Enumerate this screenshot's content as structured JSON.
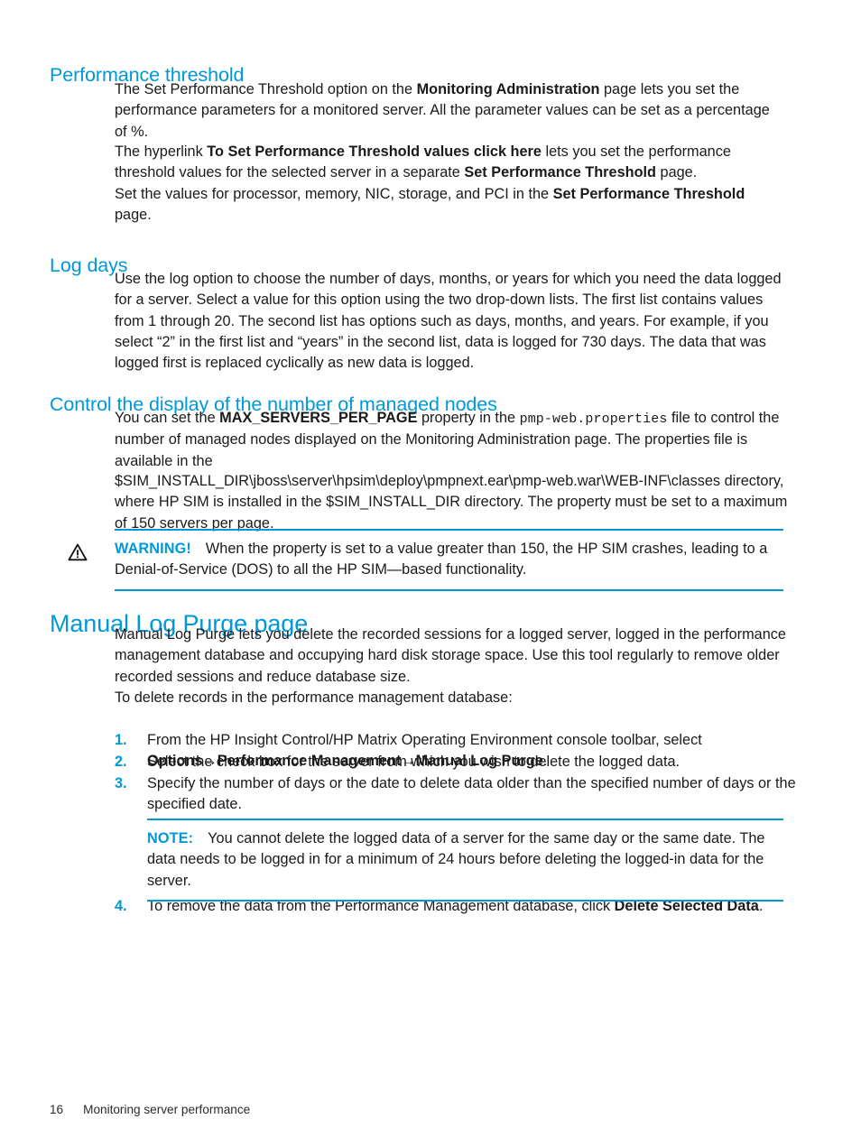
{
  "page": {
    "number": "16",
    "footer_title": "Monitoring server performance",
    "accent_color": "#0098d9",
    "text_color": "#1a1a1a"
  },
  "sections": {
    "performance_threshold": {
      "heading": "Performance threshold",
      "p1": {
        "a": "The Set Performance Threshold option on the ",
        "bold1": "Monitoring Administration",
        "b": " page lets you set the performance parameters for a monitored server. All the parameter values can be set as a percentage of %."
      },
      "p2": {
        "a": "The hyperlink ",
        "bold1": "To Set Performance Threshold values click here",
        "b": " lets you set the performance threshold values for the selected server in a separate ",
        "bold2": "Set Performance Threshold",
        "c": " page."
      },
      "p3": {
        "a": "Set the values for processor, memory, NIC, storage, and PCI in the ",
        "bold1": "Set Performance Threshold",
        "b": " page."
      }
    },
    "log_days": {
      "heading": "Log days",
      "p1": "Use the log option to choose the number of days, months, or years for which you need the data logged for a server. Select a value for this option using the two drop-down lists. The first list contains values from 1 through 20. The second list has options such as days, months, and years. For example, if you select “2” in the first list and “years” in the second list, data is logged for 730 days. The data that was logged first is replaced cyclically as new data is logged."
    },
    "control_display": {
      "heading": "Control the display of the number of managed nodes",
      "p1": {
        "a": "You can set the ",
        "bold1": "MAX_SERVERS_PER_PAGE",
        "b": " property in the ",
        "mono1": "pmp-web.properties",
        "c": " file to control the number of managed nodes displayed on the Monitoring Administration page. The properties file is available in the"
      },
      "p2": "$SIM_INSTALL_DIR\\jboss\\server\\hpsim\\deploy\\pmpnext.ear\\pmp-web.war\\WEB-INF\\classes directory, where HP SIM is installed in the $SIM_INSTALL_DIR directory. The property must be set to a maximum of 150 servers per page.",
      "warning": {
        "icon": "warning-triangle-icon",
        "label": "WARNING!",
        "text": "When the property is set to a value greater than 150, the HP SIM crashes, leading to a Denial-of-Service (DOS) to all the HP SIM—based functionality."
      }
    },
    "manual_log_purge": {
      "heading": "Manual Log Purge page",
      "p1": "Manual Log Purge lets you delete the recorded sessions for a logged server, logged in the performance management database and occupying hard disk storage space. Use this tool regularly to remove older recorded sessions and reduce database size.",
      "p2": "To delete records in the performance management database:",
      "steps": [
        {
          "num": "1.",
          "a": "From the HP Insight Control/HP Matrix Operating Environment console toolbar, select ",
          "bold1": "Options→Performance Management→Manual Log Purge",
          "b": "."
        },
        {
          "num": "2.",
          "a": "Select the check box for the server from which you wish to delete the logged data.",
          "bold1": "",
          "b": ""
        },
        {
          "num": "3.",
          "a": "Specify the number of days or the date to delete data older than the specified number of days or the specified date.",
          "bold1": "",
          "b": ""
        },
        {
          "num": "4.",
          "a": "To remove the data from the Performance Management database, click ",
          "bold1": "Delete Selected Data",
          "b": "."
        }
      ],
      "note": {
        "label": "NOTE:",
        "text": "You cannot delete the logged data of a server for the same day or the same date. The data needs to be logged in for a minimum of 24 hours before deleting the logged-in data for the server."
      }
    }
  }
}
